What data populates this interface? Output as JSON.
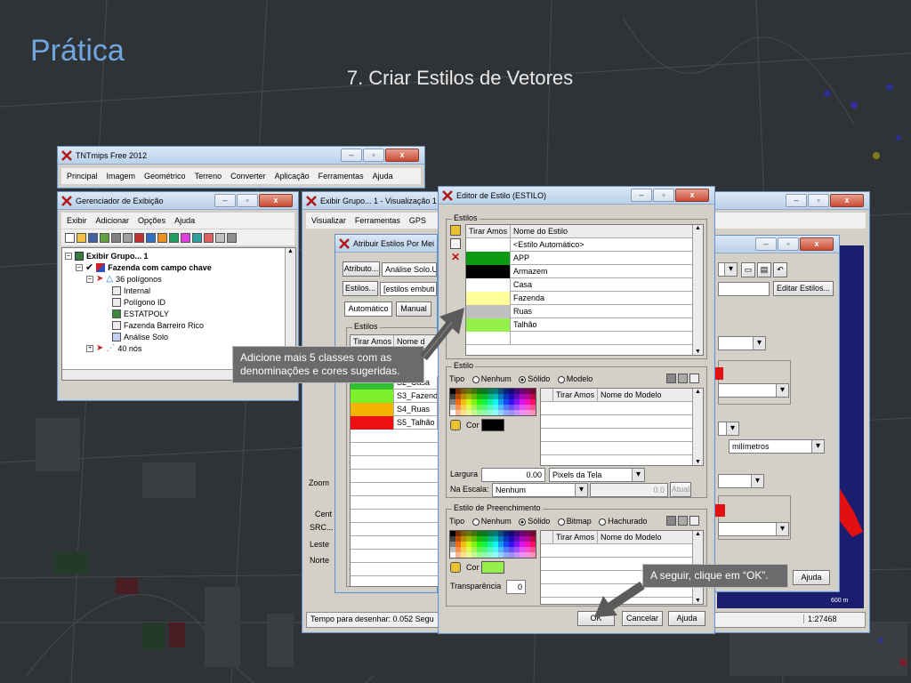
{
  "slide": {
    "title": "Prática",
    "subtitle": "7. Criar Estilos de Vetores"
  },
  "tntmips": {
    "title": "TNTmips Free 2012",
    "menu": [
      "Principal",
      "Imagem",
      "Geométrico",
      "Terreno",
      "Converter",
      "Aplicação",
      "Ferramentas",
      "Ajuda"
    ]
  },
  "gerenciador": {
    "title": "Gerenciador de Exibição",
    "menu": [
      "Exibir",
      "Adicionar",
      "Opções",
      "Ajuda"
    ],
    "tree": [
      {
        "label": "Exibir Grupo... 1",
        "bold": true,
        "indent": 0
      },
      {
        "label": "Fazenda com campo chave",
        "bold": true,
        "indent": 1
      },
      {
        "label": "36 polígonos",
        "bold": false,
        "indent": 2
      },
      {
        "label": "Internal",
        "bold": false,
        "indent": 3
      },
      {
        "label": "Polígono ID",
        "bold": false,
        "indent": 3
      },
      {
        "label": "ESTATPOLY",
        "bold": false,
        "indent": 3
      },
      {
        "label": "Fazenda Barreiro Rico",
        "bold": false,
        "indent": 3
      },
      {
        "label": "Análise Solo",
        "bold": false,
        "indent": 3
      },
      {
        "label": "40 nós",
        "bold": false,
        "indent": 2
      }
    ]
  },
  "exibir_grupo": {
    "title": "Exibir Grupo... 1 - Visualização 1",
    "menu": [
      "Visualizar",
      "Ferramentas",
      "GPS"
    ],
    "zoom_label": "Zoom",
    "center_label": "Cent",
    "src_label": "SRC...",
    "leste_label": "Leste",
    "norte_label": "Norte",
    "status": "Tempo para desenhar: 0.052 Segu",
    "scale": "1:27468",
    "scalebar": "600 m"
  },
  "atribuir": {
    "title": "Atribuir Estilos Por Mei",
    "atributo_btn": "Atributo...",
    "atributo_value": "Análise Solo.U",
    "estilos_btn": "Estilos...",
    "estilos_value": "[estilos embuti",
    "tab_auto": "Automático",
    "tab_manual": "Manual",
    "group_label": "Estilos",
    "col_tirar": "Tirar Amos",
    "col_nome": "Nome d",
    "rows": [
      {
        "color": "#2fbf2f",
        "label": "S2_Casa"
      },
      {
        "color": "#7ef02a",
        "label": "S3_Fazend"
      },
      {
        "color": "#f2b400",
        "label": "S4_Ruas"
      },
      {
        "color": "#ee1010",
        "label": "S5_Talhão"
      }
    ]
  },
  "right_panel": {
    "editar_btn": "Editar Estilos...",
    "unit_value": "milímetros",
    "ajuda_btn": "Ajuda"
  },
  "editor": {
    "title": "Editor de Estilo (ESTILO)",
    "estilos_group": "Estilos",
    "col_tirar": "Tirar Amos",
    "col_nome": "Nome do Estilo",
    "rows": [
      {
        "color": "#ffffff",
        "name": "<Estilo Automático>"
      },
      {
        "color": "#0c9a12",
        "name": "APP"
      },
      {
        "color": "#000000",
        "name": "Armazem"
      },
      {
        "color": "#ffffff",
        "name": "Casa"
      },
      {
        "color": "#ffff99",
        "name": "Fazenda"
      },
      {
        "color": "#bfbfbf",
        "name": "Ruas"
      },
      {
        "color": "#96f04c",
        "name": "Talhão"
      }
    ],
    "estilo_group": "Estilo",
    "tipo_label": "Tipo",
    "radio_nenhum": "Nenhum",
    "radio_solido": "Sólido",
    "radio_modelo": "Modelo",
    "model_col_tirar": "Tirar Amos",
    "model_col_nome": "Nome do Modelo",
    "cor_label": "Cor",
    "line_color": "#000000",
    "largura_label": "Largura",
    "largura_value": "0.00",
    "largura_unit": "Pixels da Tela",
    "escala_label": "Na Escala:",
    "escala_value": "Nenhum",
    "escala_num": "0.0",
    "atual_btn": "Atual",
    "preench_group": "Estilo de Preenchimento",
    "radio_bitmap": "Bitmap",
    "radio_hachurado": "Hachurado",
    "fill_color": "#96f04c",
    "transparencia_label": "Transparência",
    "transparencia_value": "0",
    "ok_btn": "OK",
    "cancel_btn": "Cancelar",
    "help_btn": "Ajuda"
  },
  "callouts": {
    "left": "Adicione mais 5 classes com as denominações e cores sugeridas.",
    "right": "A seguir, clique em “OK”."
  }
}
